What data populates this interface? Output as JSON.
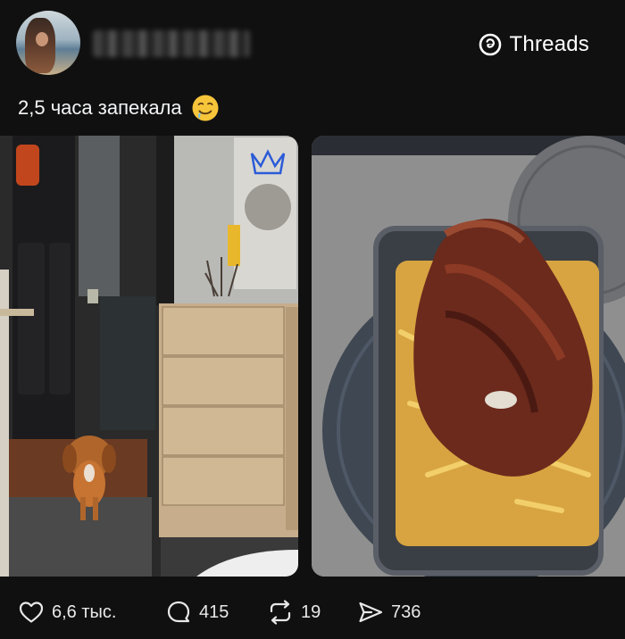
{
  "post": {
    "username": "elka_plat_an",
    "caption": "2,5 часа запекала",
    "emoji": "drooling-face"
  },
  "brand": {
    "name": "Threads"
  },
  "media": [
    {
      "description": "hallway-with-dog-and-dresser"
    },
    {
      "description": "roasted-meat-in-glass-dish"
    }
  ],
  "actions": {
    "likes": "6,6 тыс.",
    "replies": "415",
    "reposts": "19",
    "shares": "736"
  },
  "colors": {
    "background": "#101010",
    "text": "#f3f5f7"
  }
}
